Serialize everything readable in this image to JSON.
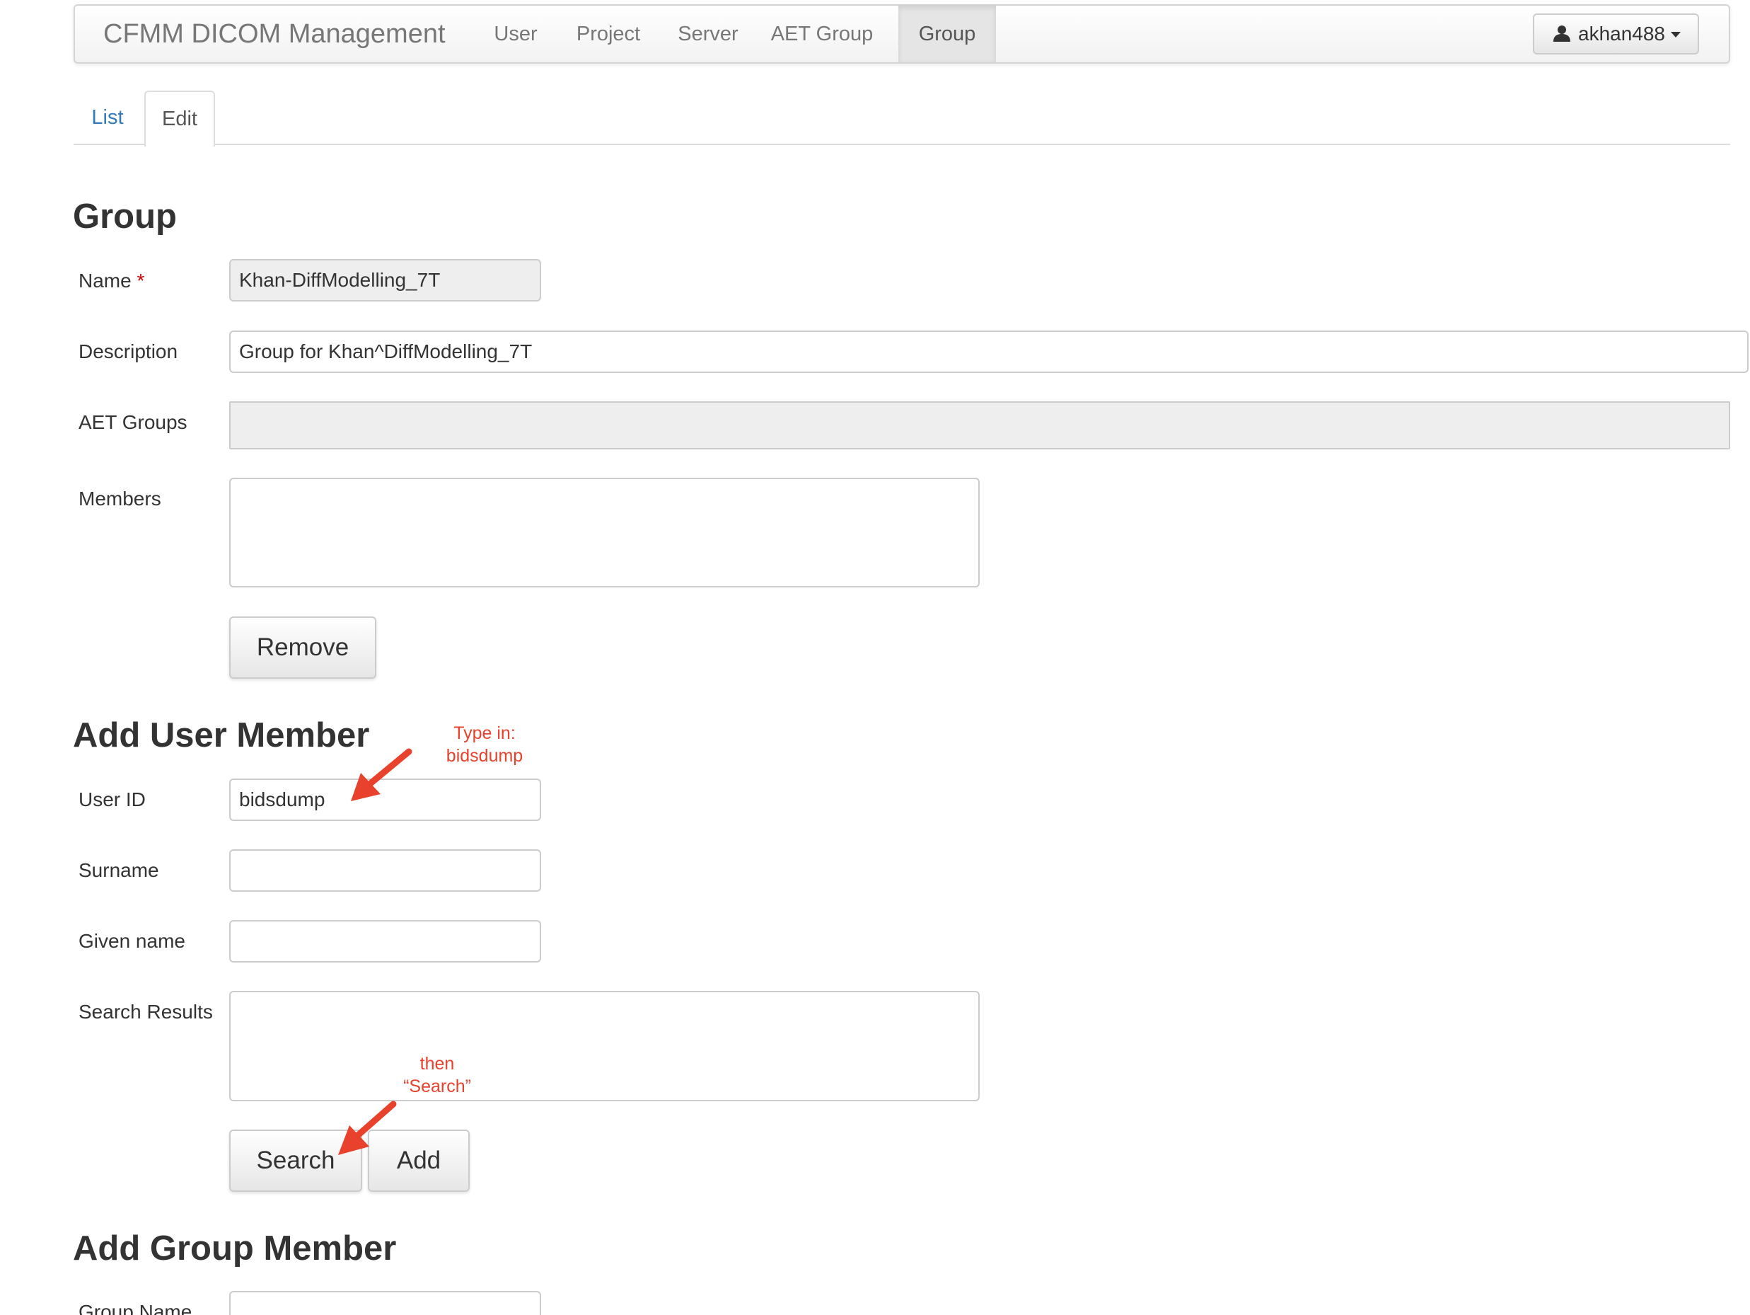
{
  "navbar": {
    "brand": "CFMM DICOM Management",
    "items": [
      {
        "label": "User",
        "active": false
      },
      {
        "label": "Project",
        "active": false
      },
      {
        "label": "Server",
        "active": false
      },
      {
        "label": "AET Group",
        "active": false
      },
      {
        "label": "Group",
        "active": true
      }
    ],
    "user_menu": {
      "username": "akhan488",
      "icon": "user-icon"
    }
  },
  "tabs": [
    {
      "label": "List",
      "active": false
    },
    {
      "label": "Edit",
      "active": true
    }
  ],
  "group_section": {
    "heading": "Group",
    "fields": {
      "name": {
        "label": "Name",
        "required_mark": "*",
        "value": "Khan-DiffModelling_7T",
        "readonly": true
      },
      "description": {
        "label": "Description",
        "value": "Group for Khan^DiffModelling_7T"
      },
      "aet_groups": {
        "label": "AET Groups",
        "value": ""
      },
      "members": {
        "label": "Members",
        "items": []
      }
    },
    "remove_button": "Remove"
  },
  "add_user_member": {
    "heading": "Add User Member",
    "fields": {
      "user_id": {
        "label": "User ID",
        "value": "bidsdump"
      },
      "surname": {
        "label": "Surname",
        "value": ""
      },
      "given_name": {
        "label": "Given name",
        "value": ""
      },
      "search_results": {
        "label": "Search Results",
        "items": []
      }
    },
    "search_button": "Search",
    "add_button": "Add"
  },
  "add_group_member": {
    "heading": "Add Group Member",
    "fields": {
      "group_name": {
        "label": "Group Name",
        "value": ""
      }
    }
  },
  "annotations": {
    "type_in_line1": "Type in:",
    "type_in_line2": "bidsdump",
    "then_line1": "then",
    "then_line2": "“Search”",
    "color": "#e8412c"
  },
  "colors": {
    "link": "#337ab7",
    "required": "#cc0000",
    "annotation": "#e8412c"
  }
}
